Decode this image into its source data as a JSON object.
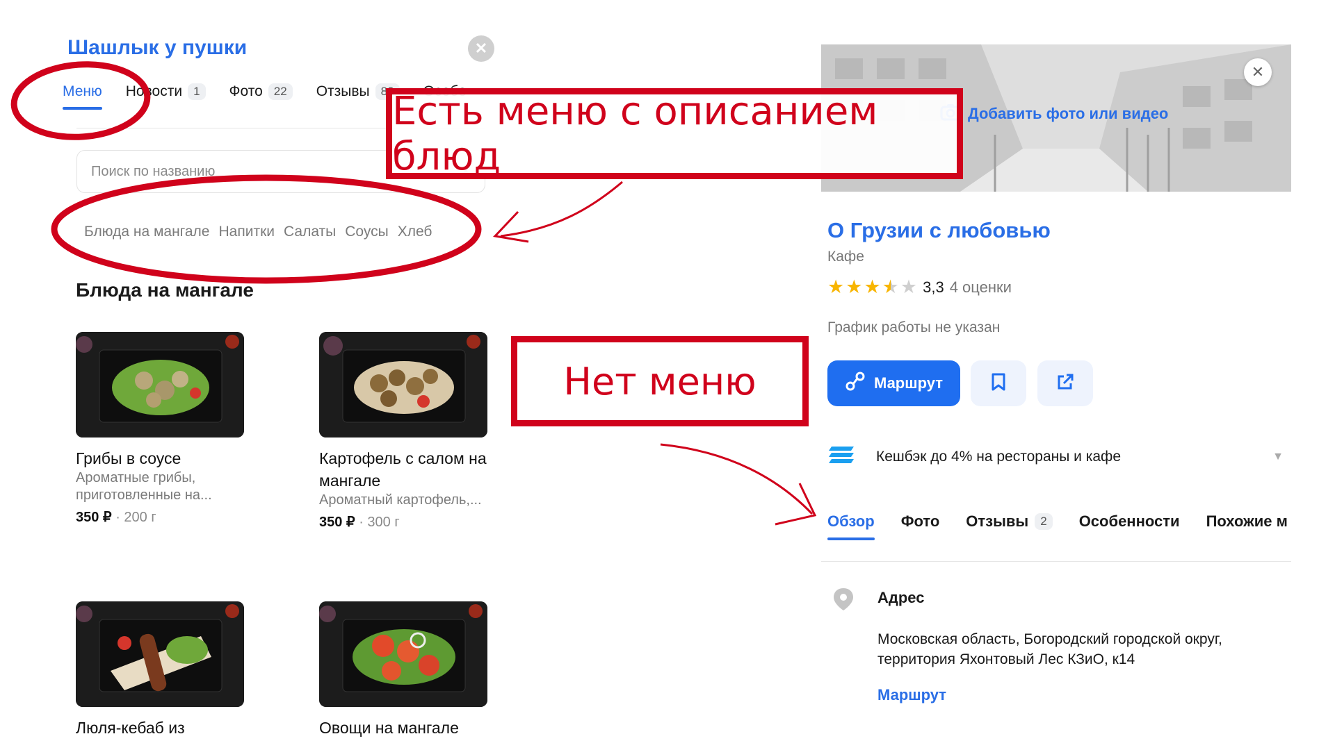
{
  "left": {
    "title": "Шашлык у пушки",
    "tabs": [
      {
        "label": "Меню",
        "count": ""
      },
      {
        "label": "Новости",
        "count": "1"
      },
      {
        "label": "Фото",
        "count": "22"
      },
      {
        "label": "Отзывы",
        "count": "82"
      },
      {
        "label": "Особе",
        "count": ""
      }
    ],
    "search_placeholder": "Поиск по названию",
    "categories": [
      "Блюда на мангале",
      "Напитки",
      "Салаты",
      "Соусы",
      "Хлеб"
    ],
    "section_title": "Блюда на мангале",
    "dishes": [
      {
        "name": "Грибы в соусе",
        "desc": "Ароматные грибы, приготовленные на...",
        "price": "350 ₽",
        "weight": "· 200 г"
      },
      {
        "name": "Картофель с салом на мангале",
        "desc": "Ароматный картофель,...",
        "price": "350 ₽",
        "weight": "· 300 г"
      },
      {
        "name": "Люля-кебаб из",
        "desc": "",
        "price": "",
        "weight": ""
      },
      {
        "name": "Овощи на мангале",
        "desc": "",
        "price": "",
        "weight": ""
      }
    ]
  },
  "right": {
    "add_photo": "Добавить фото или видео",
    "name": "О Грузии с любовью",
    "category": "Кафе",
    "rating": "3,3",
    "rating_value": 3.3,
    "reviews_count": "4 оценки",
    "hours": "График работы не указан",
    "route_button": "Маршрут",
    "cashback": "Кешбэк до 4% на рестораны и кафе",
    "tabs": [
      {
        "label": "Обзор",
        "count": ""
      },
      {
        "label": "Фото",
        "count": ""
      },
      {
        "label": "Отзывы",
        "count": "2"
      },
      {
        "label": "Особенности",
        "count": ""
      },
      {
        "label": "Похожие м",
        "count": ""
      }
    ],
    "address_label": "Адрес",
    "address_text": "Московская область, Богородский городской округ, территория Яхонтовый Лес КЗиО, к14",
    "address_route": "Маршрут"
  },
  "annotations": {
    "has_menu": "Есть меню с описанием блюд",
    "no_menu": "Нет меню"
  },
  "colors": {
    "accent": "#2a6ee6",
    "annotation": "#d0021b",
    "star": "#f8b500"
  }
}
